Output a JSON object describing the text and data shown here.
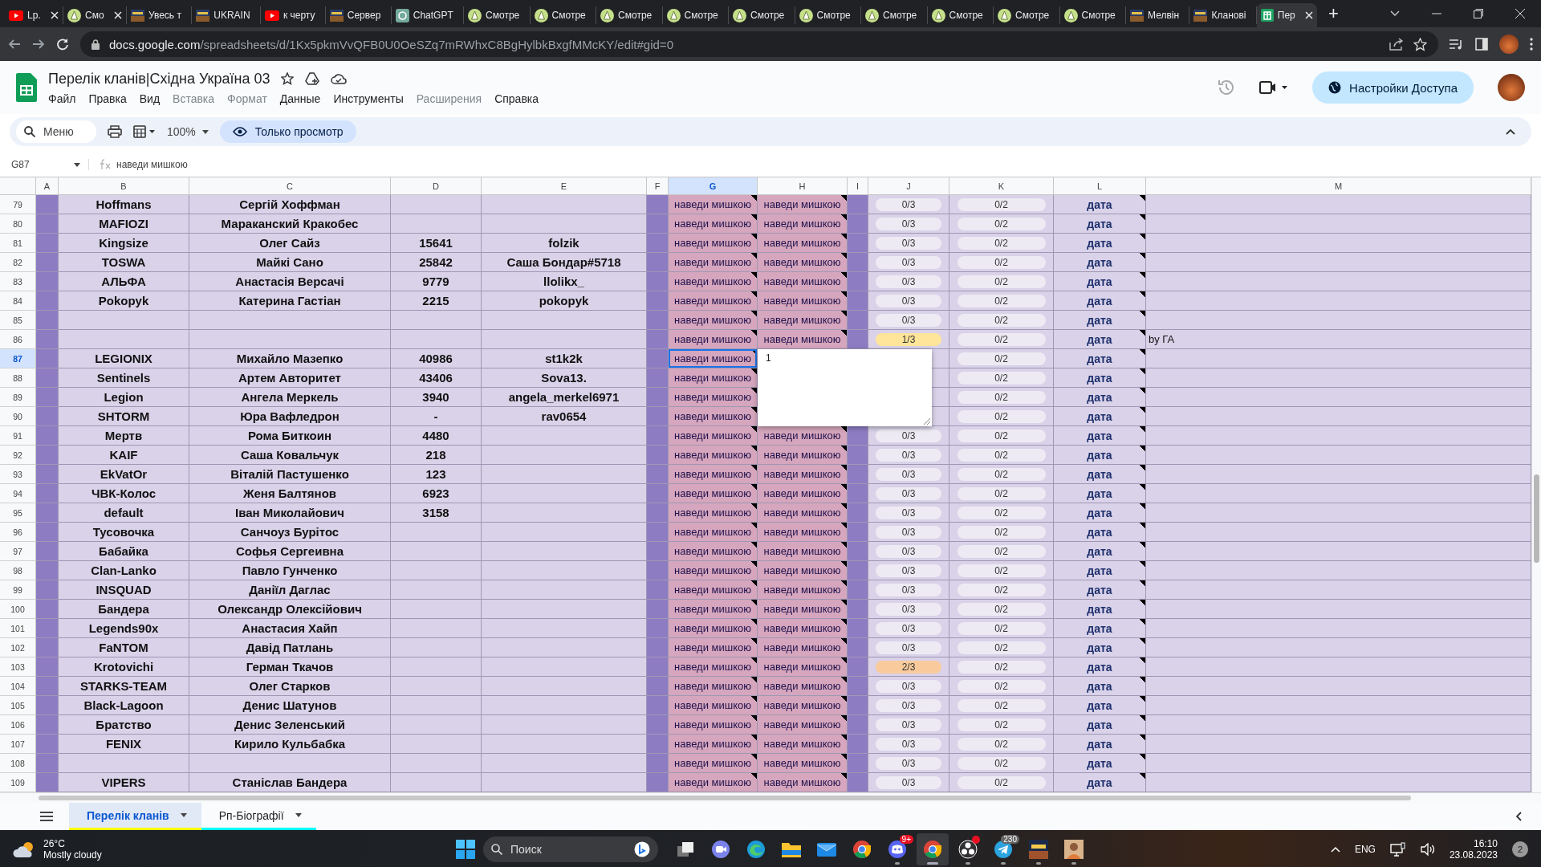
{
  "browser": {
    "tabs": [
      {
        "title": "Lp.",
        "kind": "youtube",
        "close": true,
        "selected": false
      },
      {
        "title": "Смо",
        "kind": "smotre",
        "close": true,
        "selected": false
      },
      {
        "title": "Увесь т",
        "kind": "clan",
        "close": false,
        "selected": false
      },
      {
        "title": "UKRAIN",
        "kind": "clan",
        "close": false,
        "selected": false
      },
      {
        "title": "к черту",
        "kind": "youtube",
        "close": false,
        "selected": false
      },
      {
        "title": "Сервер",
        "kind": "clan",
        "close": false,
        "selected": false
      },
      {
        "title": "ChatGPT",
        "kind": "chatgpt",
        "close": false,
        "selected": false
      },
      {
        "title": "Смотре",
        "kind": "smotre",
        "close": false,
        "selected": false
      },
      {
        "title": "Смотре",
        "kind": "smotre",
        "close": false,
        "selected": false
      },
      {
        "title": "Смотре",
        "kind": "smotre",
        "close": false,
        "selected": false
      },
      {
        "title": "Смотре",
        "kind": "smotre",
        "close": false,
        "selected": false
      },
      {
        "title": "Смотре",
        "kind": "smotre",
        "close": false,
        "selected": false
      },
      {
        "title": "Смотре",
        "kind": "smotre",
        "close": false,
        "selected": false
      },
      {
        "title": "Смотре",
        "kind": "smotre",
        "close": false,
        "selected": false
      },
      {
        "title": "Смотре",
        "kind": "smotre",
        "close": false,
        "selected": false
      },
      {
        "title": "Смотре",
        "kind": "smotre",
        "close": false,
        "selected": false
      },
      {
        "title": "Смотре",
        "kind": "smotre",
        "close": false,
        "selected": false
      },
      {
        "title": "Мелвін",
        "kind": "clan",
        "close": false,
        "selected": false
      },
      {
        "title": "Кланові",
        "kind": "clan",
        "close": false,
        "selected": false
      },
      {
        "title": "Пер",
        "kind": "sheets",
        "close": true,
        "selected": true
      }
    ],
    "new_tab": "+",
    "url_host": "docs.google.com",
    "url_path": "/spreadsheets/d/1Kx5pkmVvQFB0U0OeSZq7mRWhxC8BgHylbkBxgfMMcKY/edit#gid=0"
  },
  "doc": {
    "title": "Перелік кланів|Східна Україна 03",
    "menus": [
      {
        "label": "Файл",
        "disabled": false
      },
      {
        "label": "Правка",
        "disabled": false
      },
      {
        "label": "Вид",
        "disabled": false
      },
      {
        "label": "Вставка",
        "disabled": true
      },
      {
        "label": "Формат",
        "disabled": true
      },
      {
        "label": "Данные",
        "disabled": false
      },
      {
        "label": "Инструменты",
        "disabled": false
      },
      {
        "label": "Расширения",
        "disabled": true
      },
      {
        "label": "Справка",
        "disabled": false
      }
    ],
    "share_button": "Настройки Доступа"
  },
  "toolbar": {
    "search": "Меню",
    "zoom": "100%",
    "mode_button": "Только просмотр"
  },
  "formula_bar": {
    "cell_ref": "G87",
    "content": "наведи мишкою"
  },
  "columns": [
    {
      "label": "A",
      "selected": false
    },
    {
      "label": "B",
      "selected": false
    },
    {
      "label": "C",
      "selected": false
    },
    {
      "label": "D",
      "selected": false
    },
    {
      "label": "E",
      "selected": false
    },
    {
      "label": "F",
      "selected": false
    },
    {
      "label": "G",
      "selected": true
    },
    {
      "label": "H",
      "selected": false
    },
    {
      "label": "I",
      "selected": false
    },
    {
      "label": "J",
      "selected": false
    },
    {
      "label": "K",
      "selected": false
    },
    {
      "label": "L",
      "selected": false
    },
    {
      "label": "M",
      "selected": false
    }
  ],
  "rows": [
    {
      "num": "79",
      "selected": false,
      "b": "Hoffmans",
      "c": "Сергій Хоффман",
      "g": "наведи мишкою",
      "h": "наведи мишкою",
      "j": {
        "text": "0/3",
        "color": "#eeeaf3"
      },
      "k": "0/2",
      "l": "дата"
    },
    {
      "num": "80",
      "selected": false,
      "b": "MAFIOZI",
      "c": "Мараканский Кракобес",
      "g": "наведи мишкою",
      "h": "наведи мишкою",
      "j": {
        "text": "0/3",
        "color": "#eeeaf3"
      },
      "k": "0/2",
      "l": "дата"
    },
    {
      "num": "81",
      "selected": false,
      "b": "Kingsize",
      "c": "Олег Сайз",
      "d": "15641",
      "e": "folzik",
      "g": "наведи мишкою",
      "h": "наведи мишкою",
      "j": {
        "text": "0/3",
        "color": "#eeeaf3"
      },
      "k": "0/2",
      "l": "дата"
    },
    {
      "num": "82",
      "selected": false,
      "b": "TOSWA",
      "c": "Майкі Сано",
      "d": "25842",
      "e": "Саша Бондар#5718",
      "g": "наведи мишкою",
      "h": "наведи мишкою",
      "j": {
        "text": "0/3",
        "color": "#eeeaf3"
      },
      "k": "0/2",
      "l": "дата"
    },
    {
      "num": "83",
      "selected": false,
      "b": "АЛЬФА",
      "c": "Анастасія Версачі",
      "d": "9779",
      "e": "llolikx_",
      "g": "наведи мишкою",
      "h": "наведи мишкою",
      "j": {
        "text": "0/3",
        "color": "#eeeaf3"
      },
      "k": "0/2",
      "l": "дата"
    },
    {
      "num": "84",
      "selected": false,
      "b": "Pokopyk",
      "c": "Катерина Гастіан",
      "d": "2215",
      "e": "pokopyk",
      "g": "наведи мишкою",
      "h": "наведи мишкою",
      "j": {
        "text": "0/3",
        "color": "#eeeaf3"
      },
      "k": "0/2",
      "l": "дата"
    },
    {
      "num": "85",
      "selected": false,
      "g": "наведи мишкою",
      "h": "наведи мишкою",
      "j": {
        "text": "0/3",
        "color": "#eeeaf3"
      },
      "k": "0/2",
      "l": "дата"
    },
    {
      "num": "86",
      "selected": false,
      "g": "наведи мишкою",
      "h": "наведи мишкою",
      "j": {
        "text": "1/3",
        "color": "#ffe599"
      },
      "k": "0/2",
      "l": "дата",
      "m": "by ГА"
    },
    {
      "num": "87",
      "selected": true,
      "b": "LEGIONIX",
      "c": "Михайло Мазепко",
      "d": "40986",
      "e": "st1k2k",
      "g": "наведи мишкою",
      "k": "0/2",
      "l": "дата"
    },
    {
      "num": "88",
      "selected": false,
      "b": "Sentinels",
      "c": "Артем Авторитет",
      "d": "43406",
      "e": "Sova13.",
      "g": "наведи мишкою",
      "k": "0/2",
      "l": "дата"
    },
    {
      "num": "89",
      "selected": false,
      "b": "Legion",
      "c": "Ангела Меркель",
      "d": "3940",
      "e": "angela_merkel6971",
      "g": "наведи мишкою",
      "k": "0/2",
      "l": "дата"
    },
    {
      "num": "90",
      "selected": false,
      "b": "SHTORM",
      "c": "Юра Вафледрон",
      "d": "-",
      "e": "rav0654",
      "g": "наведи мишкою",
      "k": "0/2",
      "l": "дата"
    },
    {
      "num": "91",
      "selected": false,
      "b": "Мертв",
      "c": "Рома Биткоин",
      "d": "4480",
      "g": "наведи мишкою",
      "h": "наведи мишкою",
      "j": {
        "text": "0/3",
        "color": "#eeeaf3"
      },
      "k": "0/2",
      "l": "дата"
    },
    {
      "num": "92",
      "selected": false,
      "b": "KAIF",
      "c": "Саша Ковальчук",
      "d": "218",
      "g": "наведи мишкою",
      "h": "наведи мишкою",
      "j": {
        "text": "0/3",
        "color": "#eeeaf3"
      },
      "k": "0/2",
      "l": "дата"
    },
    {
      "num": "93",
      "selected": false,
      "b": "EkVatOr",
      "c": "Віталій Пастушенко",
      "d": "123",
      "g": "наведи мишкою",
      "h": "наведи мишкою",
      "j": {
        "text": "0/3",
        "color": "#eeeaf3"
      },
      "k": "0/2",
      "l": "дата"
    },
    {
      "num": "94",
      "selected": false,
      "b": "ЧВК-Колос",
      "c": "Женя Балтянов",
      "d": "6923",
      "g": "наведи мишкою",
      "h": "наведи мишкою",
      "j": {
        "text": "0/3",
        "color": "#eeeaf3"
      },
      "k": "0/2",
      "l": "дата"
    },
    {
      "num": "95",
      "selected": false,
      "b": "default",
      "c": "Іван Миколайович",
      "d": "3158",
      "g": "наведи мишкою",
      "h": "наведи мишкою",
      "j": {
        "text": "0/3",
        "color": "#eeeaf3"
      },
      "k": "0/2",
      "l": "дата"
    },
    {
      "num": "96",
      "selected": false,
      "b": "Тусовочка",
      "c": "Санчоуз Бурітос",
      "g": "наведи мишкою",
      "h": "наведи мишкою",
      "j": {
        "text": "0/3",
        "color": "#eeeaf3"
      },
      "k": "0/2",
      "l": "дата"
    },
    {
      "num": "97",
      "selected": false,
      "b": "Бабайка",
      "c": "Софья Сергеивна",
      "g": "наведи мишкою",
      "h": "наведи мишкою",
      "j": {
        "text": "0/3",
        "color": "#eeeaf3"
      },
      "k": "0/2",
      "l": "дата"
    },
    {
      "num": "98",
      "selected": false,
      "b": "Clan-Lanko",
      "c": "Павло Гунченко",
      "g": "наведи мишкою",
      "h": "наведи мишкою",
      "j": {
        "text": "0/3",
        "color": "#eeeaf3"
      },
      "k": "0/2",
      "l": "дата"
    },
    {
      "num": "99",
      "selected": false,
      "b": "INSQUAD",
      "c": "Даніїл Даглас",
      "g": "наведи мишкою",
      "h": "наведи мишкою",
      "j": {
        "text": "0/3",
        "color": "#eeeaf3"
      },
      "k": "0/2",
      "l": "дата"
    },
    {
      "num": "100",
      "selected": false,
      "b": "Бандера",
      "c": "Олександр Олексійович",
      "g": "наведи мишкою",
      "h": "наведи мишкою",
      "j": {
        "text": "0/3",
        "color": "#eeeaf3"
      },
      "k": "0/2",
      "l": "дата"
    },
    {
      "num": "101",
      "selected": false,
      "b": "Legends90x",
      "c": "Анастасия Хайп",
      "g": "наведи мишкою",
      "h": "наведи мишкою",
      "j": {
        "text": "0/3",
        "color": "#eeeaf3"
      },
      "k": "0/2",
      "l": "дата"
    },
    {
      "num": "102",
      "selected": false,
      "b": "FaNTOM",
      "c": "Давід Патлань",
      "g": "наведи мишкою",
      "h": "наведи мишкою",
      "j": {
        "text": "0/3",
        "color": "#eeeaf3"
      },
      "k": "0/2",
      "l": "дата"
    },
    {
      "num": "103",
      "selected": false,
      "b": "Krotovichi",
      "c": "Герман Ткачов",
      "g": "наведи мишкою",
      "h": "наведи мишкою",
      "j": {
        "text": "2/3",
        "color": "#f9cb9c"
      },
      "k": "0/2",
      "l": "дата"
    },
    {
      "num": "104",
      "selected": false,
      "b": "STARKS-TEAM",
      "c": "Олег Старков",
      "g": "наведи мишкою",
      "h": "наведи мишкою",
      "j": {
        "text": "0/3",
        "color": "#eeeaf3"
      },
      "k": "0/2",
      "l": "дата"
    },
    {
      "num": "105",
      "selected": false,
      "b": "Black-Lagoon",
      "c": "Денис Шатунов",
      "g": "наведи мишкою",
      "h": "наведи мишкою",
      "j": {
        "text": "0/3",
        "color": "#eeeaf3"
      },
      "k": "0/2",
      "l": "дата"
    },
    {
      "num": "106",
      "selected": false,
      "b": "Братство",
      "c": "Денис Зеленський",
      "g": "наведи мишкою",
      "h": "наведи мишкою",
      "j": {
        "text": "0/3",
        "color": "#eeeaf3"
      },
      "k": "0/2",
      "l": "дата"
    },
    {
      "num": "107",
      "selected": false,
      "b": "FENIX",
      "c": "Кирило Кульбабка",
      "g": "наведи мишкою",
      "h": "наведи мишкою",
      "j": {
        "text": "0/3",
        "color": "#eeeaf3"
      },
      "k": "0/2",
      "l": "дата"
    },
    {
      "num": "108",
      "selected": false,
      "g": "наведи мишкою",
      "h": "наведи мишкою",
      "j": {
        "text": "0/3",
        "color": "#eeeaf3"
      },
      "k": "0/2",
      "l": "дата"
    },
    {
      "num": "109",
      "selected": false,
      "b": "VIPERS",
      "c": "Станіслав Бандера",
      "g": "наведи мишкою",
      "h": "наведи мишкою",
      "j": {
        "text": "0/3",
        "color": "#eeeaf3"
      },
      "k": "0/2",
      "l": "дата"
    }
  ],
  "note": {
    "text": "1"
  },
  "sheet_tabs": [
    {
      "label": "Перелік кланів",
      "selected": true,
      "color": "#ffff00"
    },
    {
      "label": "Рп-Біографії",
      "selected": false,
      "color": "#00ffff"
    }
  ],
  "taskbar": {
    "weather_temp": "26°C",
    "weather_text": "Mostly cloudy",
    "search": "Поиск",
    "apps": [
      {
        "kind": "taskview",
        "running": false,
        "active": false,
        "alert": false
      },
      {
        "kind": "chat",
        "running": false,
        "active": false,
        "alert": false
      },
      {
        "kind": "edge",
        "running": false,
        "active": false,
        "alert": false
      },
      {
        "kind": "explorer",
        "running": false,
        "active": false,
        "alert": false
      },
      {
        "kind": "mail",
        "running": false,
        "active": false,
        "alert": false
      },
      {
        "kind": "chrome",
        "running": false,
        "active": false,
        "alert": false
      },
      {
        "kind": "discord",
        "running": true,
        "active": false,
        "alert": false,
        "badge": "9+"
      },
      {
        "kind": "chrome",
        "running": true,
        "active": true,
        "alert": false
      },
      {
        "kind": "obs",
        "running": true,
        "active": false,
        "alert": true
      },
      {
        "kind": "telegram",
        "running": true,
        "active": false,
        "alert": false,
        "badge": "230"
      },
      {
        "kind": "game",
        "running": true,
        "active": false,
        "alert": false
      },
      {
        "kind": "photo",
        "running": true,
        "active": false,
        "alert": false
      }
    ],
    "language": "ENG",
    "time": "16:10",
    "date": "23.08.2023",
    "notifications": "2"
  }
}
